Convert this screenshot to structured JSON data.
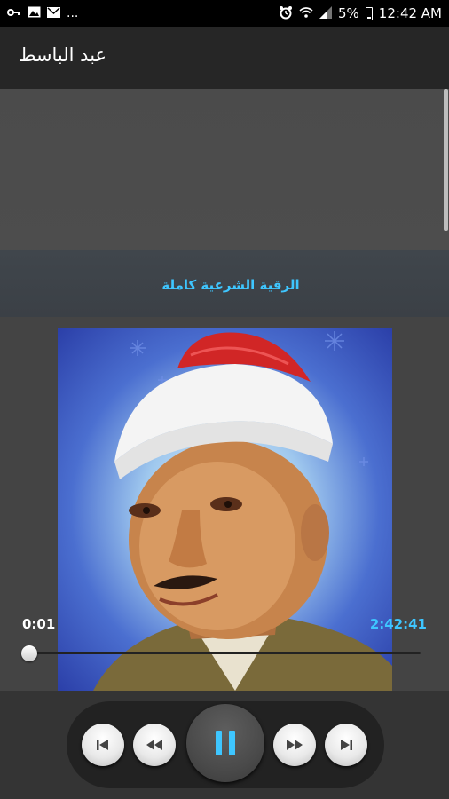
{
  "status_bar": {
    "left_icons": [
      "key-icon",
      "image-icon",
      "mail-icon",
      "more-dots"
    ],
    "more": "...",
    "right_icons": [
      "alarm-icon",
      "wifi-icon",
      "signal-icon"
    ],
    "battery": "5%",
    "time": "12:42 AM"
  },
  "app_bar": {
    "title": "عبد الباسط"
  },
  "playlist": {
    "items": [
      {
        "title": "الرقية الشرعية كاملة"
      }
    ]
  },
  "player": {
    "elapsed": "0:01",
    "duration": "2:42:41",
    "progress_fraction": 0.0001,
    "controls": [
      "previous-icon",
      "rewind-icon",
      "pause-icon",
      "fast-forward-icon",
      "next-icon"
    ]
  },
  "colors": {
    "accent": "#3ec6ff",
    "app_bar": "#262626",
    "background": "#444444"
  }
}
